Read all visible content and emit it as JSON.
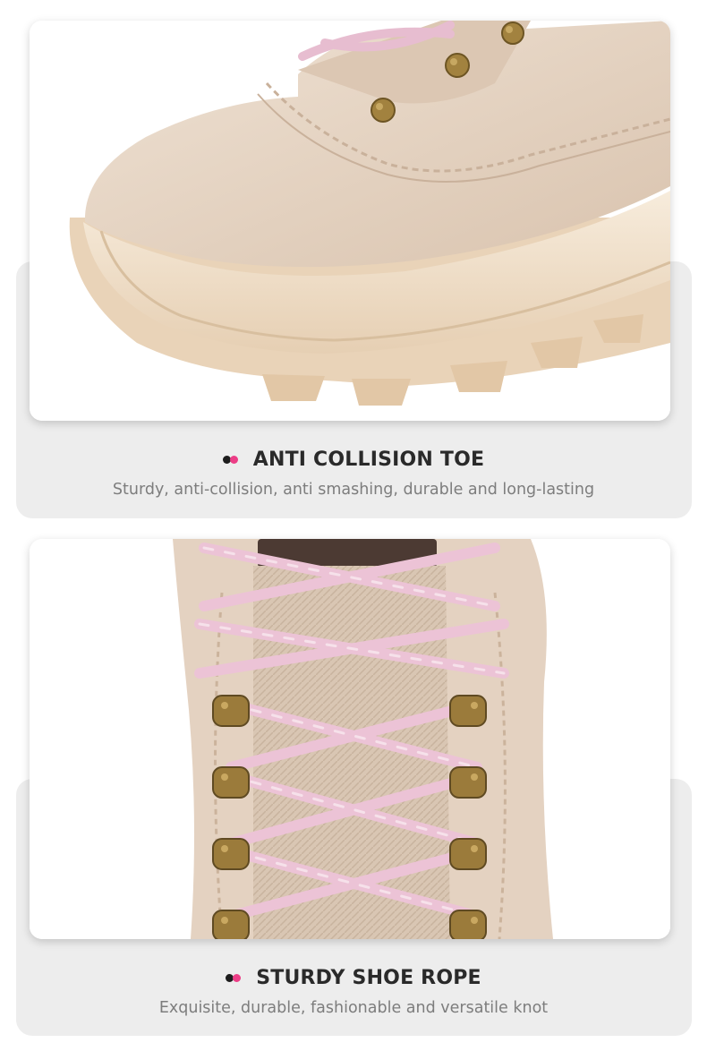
{
  "features": [
    {
      "title": "ANTI COLLISION TOE",
      "description": "Sturdy, anti-collision, anti smashing, durable and long-lasting",
      "image": "boot-toe-closeup"
    },
    {
      "title": "STURDY SHOE ROPE",
      "description": "Exquisite, durable, fashionable and versatile knot",
      "image": "boot-laces-closeup"
    }
  ],
  "colors": {
    "band": "#ededed",
    "accent_pink": "#ec3d86",
    "accent_dark": "#1d1d1d",
    "boot_leather": "#e7d6c5",
    "sole": "#f0ddc6",
    "lace": "#ecc3d6",
    "eyelet": "#9b7b3b"
  }
}
